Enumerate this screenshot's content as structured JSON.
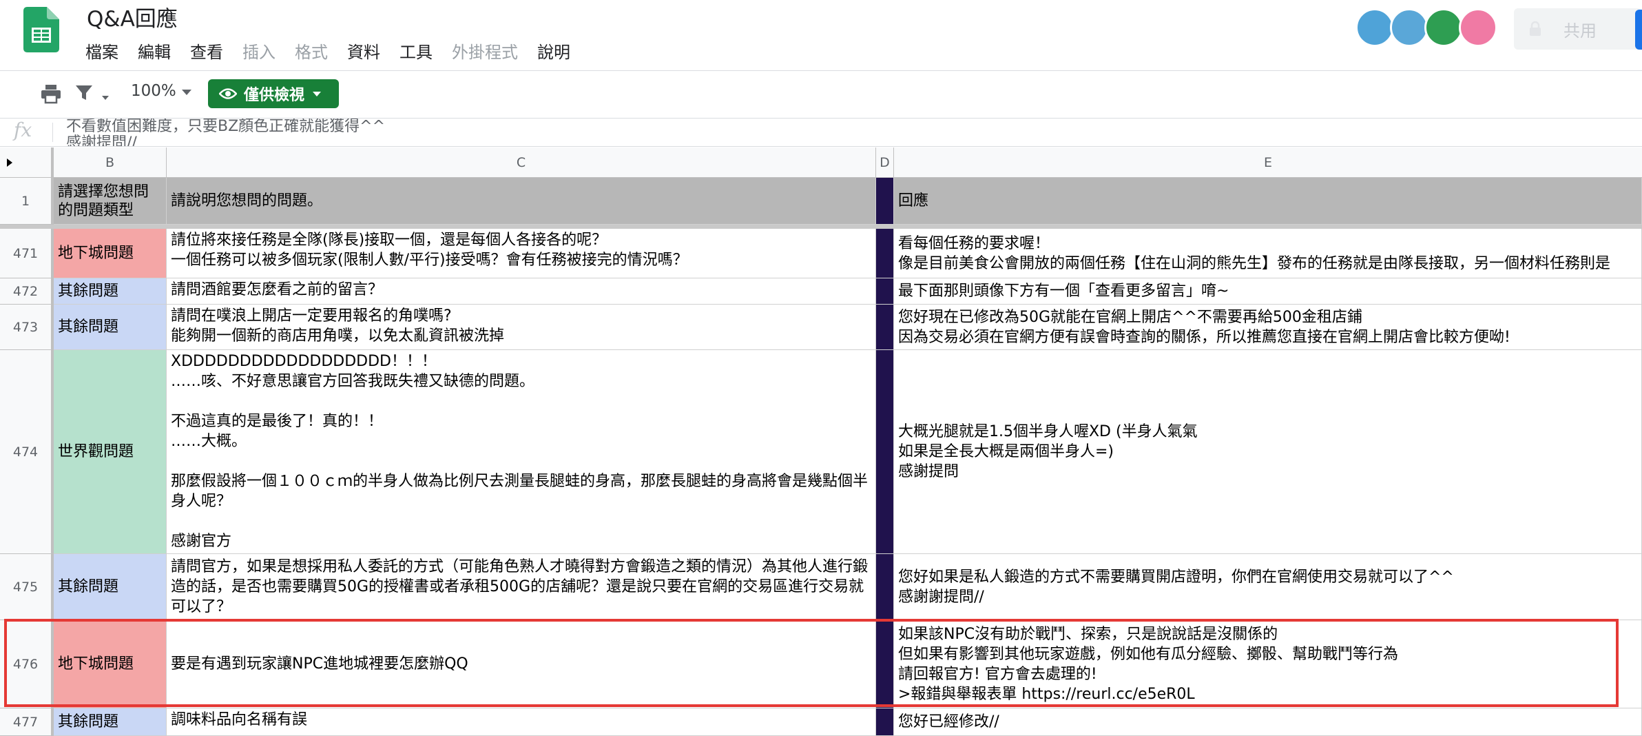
{
  "app": {
    "title": "Q&A回應",
    "menu": [
      {
        "label": "檔案",
        "disabled": false
      },
      {
        "label": "編輯",
        "disabled": false
      },
      {
        "label": "查看",
        "disabled": false
      },
      {
        "label": "插入",
        "disabled": true
      },
      {
        "label": "格式",
        "disabled": true
      },
      {
        "label": "資料",
        "disabled": false
      },
      {
        "label": "工具",
        "disabled": false
      },
      {
        "label": "外掛程式",
        "disabled": true
      },
      {
        "label": "說明",
        "disabled": false
      }
    ],
    "share_label": "共用",
    "avatars": [
      {
        "icon": "panda-avatar-icon",
        "color": "#4fa3d8"
      },
      {
        "icon": "dog-avatar-icon",
        "color": "#5aa7d8"
      },
      {
        "icon": "lion-avatar-icon",
        "color": "#2e9e52"
      },
      {
        "icon": "cake-avatar-icon",
        "color": "#f07aa4"
      }
    ]
  },
  "toolbar": {
    "zoom": "100%",
    "view_only_label": "僅供檢視",
    "accent": "#188038"
  },
  "formula_bar": {
    "fx": "fx",
    "text": "不看數值困難度，只要BZ顏色正確就能獲得^^\n感謝提問//"
  },
  "columns": [
    "B",
    "C",
    "D",
    "E"
  ],
  "header_row": {
    "row": "1",
    "type": "請選擇您想問的問題類型",
    "question": "請說明您想問的問題。",
    "answer": "回應"
  },
  "rows": [
    {
      "row": "471",
      "type": "地下城問題",
      "question": "請位將來接任務是全隊(隊長)接取一個，還是每個人各接各的呢？\n一個任務可以被多個玩家(限制人數/平行)接受嗎？會有任務被接完的情況嗎？",
      "answer": "看每個任務的要求喔！\n像是目前美食公會開放的兩個任務【住在山洞的熊先生】發布的任務就是由隊長接取，另一個材料任務則是"
    },
    {
      "row": "472",
      "type": "其餘問題",
      "question": "請問酒館要怎麼看之前的留言？",
      "answer": "最下面那則頭像下方有一個「查看更多留言」唷~"
    },
    {
      "row": "473",
      "type": "其餘問題",
      "question": "請問在噗浪上開店一定要用報名的角噗嗎?\n能夠開一個新的商店用角噗，以免太亂資訊被洗掉",
      "answer": "您好現在已修改為50G就能在官網上開店^^不需要再給500金租店鋪\n因為交易必須在官網方便有誤會時查詢的關係，所以推薦您直接在官網上開店會比較方便呦!"
    },
    {
      "row": "474",
      "type": "世界觀問題",
      "question": "XDDDDDDDDDDDDDDDDDD！！！\n……咳、不好意思讓官方回答我既失禮又缺德的問題。\n\n不過這真的是最後了！真的！！\n……大概。\n\n那麼假設將一個１００ｃｍ的半身人做為比例尺去測量長腿蛙的身高，那麼長腿蛙的身高將會是幾點個半身人呢？\n\n感謝官方",
      "answer": "大概光腿就是1.5個半身人喔XD (半身人氣氣\n如果是全長大概是兩個半身人=)\n感謝提問"
    },
    {
      "row": "475",
      "type": "其餘問題",
      "question": "請問官方，如果是想採用私人委託的方式（可能角色熟人才曉得對方會鍛造之類的情況）為其他人進行鍛造的話，是否也需要購買50G的授權書或者承租500G的店舖呢？還是說只要在官網的交易區進行交易就可以了？",
      "answer": "您好如果是私人鍛造的方式不需要購買開店證明，你們在官網使用交易就可以了^^\n感謝謝提問//"
    },
    {
      "row": "476",
      "type": "地下城問題",
      "question": "要是有遇到玩家讓NPC進地城裡要怎麼辦QQ",
      "answer": "如果該NPC沒有助於戰鬥、探索，只是說說話是沒關係的\n但如果有影響到其他玩家遊戲，例如他有瓜分經驗、擲骰、幫助戰鬥等行為\n請回報官方! 官方會去處理的!\n>報錯與舉報表單 https://reurl.cc/e5eR0L"
    },
    {
      "row": "477",
      "type": "其餘問題",
      "question": "調味料品向名稱有誤",
      "answer": "您好已經修改//"
    }
  ],
  "category_colors": {
    "地下城問題": "#f4a6a6",
    "其餘問題": "#c9d7f5",
    "世界觀問題": "#b6e1cd"
  }
}
